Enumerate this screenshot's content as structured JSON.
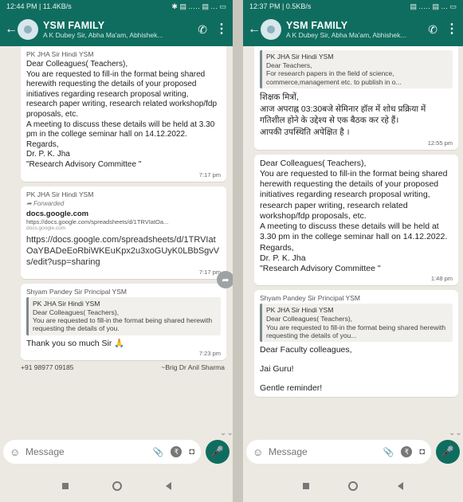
{
  "left": {
    "status": {
      "time": "12:44 PM | 11.4KB/s",
      "right": "✱ ▤ .‥‥ ▤ .‥ ▭"
    },
    "header": {
      "title": "YSM FAMILY",
      "subtitle": "A K Dubey Sir, Abha Ma'am, Abhishek..."
    },
    "messages": {
      "m1": {
        "sender": "PK JHA Sir Hindi YSM",
        "body": "Dear Colleagues( Teachers),\nYou are requested to fill-in the format being shared herewith requesting the details of your proposed initiatives regarding research proposal writing, research paper writing, research related workshop/fdp proposals, etc.\nA meeting to discuss these details will be held at 3.30 pm in the college seminar hall on 14.12.2022.\nRegards,\nDr. P. K. Jha\n \"Research Advisory Committee \"",
        "time": "7:17 pm"
      },
      "m2": {
        "sender": "PK JHA Sir Hindi YSM",
        "forwarded": "Forwarded",
        "link_title": "docs.google.com",
        "link_url": "https://docs.google.com/spreadsheets/d/1TRVIatOa...",
        "link_domain": "docs.google.com",
        "url_text": "https://docs.google.com/spreadsheets/d/1TRVIatOaYBADeEoRbiWKEuKpx2u3xoGUyK0LBbSgvVs/edit?usp=sharing",
        "time": "7:17 pm"
      },
      "m3": {
        "sender": "Shyam Pandey Sir Principal YSM",
        "quote_sender": "PK JHA Sir Hindi YSM",
        "quote_body": "Dear Colleagues( Teachers),\nYou are requested to fill-in the format being shared herewith requesting the details of you.",
        "body": "Thank you so much Sir 🙏",
        "time": "7:23 pm"
      },
      "bottom": {
        "phone": "+91 98977 09185",
        "name": "~Brig Dr Anil Sharma"
      }
    },
    "composer": {
      "placeholder": "Message"
    }
  },
  "right": {
    "status": {
      "time": "12:37 PM | 0.5KB/s",
      "right": "▤ .‥‥ ▤ .‥ ▭"
    },
    "header": {
      "title": "YSM FAMILY",
      "subtitle": "A K Dubey Sir, Abha Ma'am, Abhishek..."
    },
    "messages": {
      "m1": {
        "quote_sender": "PK JHA Sir Hindi YSM",
        "quote_body": "Dear Teachers,\nFor research papers in the field of science, commerce,management etc.  to publish in o...",
        "body": "शिक्षक मित्रों,\nआज अपराह्न 03:30बजे सेमिनार हॉल में शोध प्रक्रिया में गतिशील होने के उद्देश्य से एक बैठक कर रहे हैं।\nआपकी उपस्थिति अपेक्षित है ।",
        "time": "12:55 pm"
      },
      "m2": {
        "body": "Dear Colleagues( Teachers),\nYou are requested to fill-in the format being shared herewith requesting the details of your proposed initiatives regarding research proposal writing, research paper writing, research related workshop/fdp proposals, etc.\nA meeting to discuss these details will be held at 3.30 pm in the college seminar hall on 14.12.2022.\nRegards,\nDr. P. K. Jha\n \"Research Advisory Committee \"",
        "time": "1:48 pm"
      },
      "m3": {
        "sender": "Shyam Pandey Sir Principal YSM",
        "quote_sender": "PK JHA Sir Hindi YSM",
        "quote_body": "Dear Colleagues( Teachers),\nYou are requested to fill-in the format being shared herewith requesting the details of you...",
        "line1": "Dear Faculty colleagues,",
        "line2": "Jai Guru!",
        "line3": "Gentle reminder!"
      }
    },
    "composer": {
      "placeholder": "Message"
    }
  }
}
